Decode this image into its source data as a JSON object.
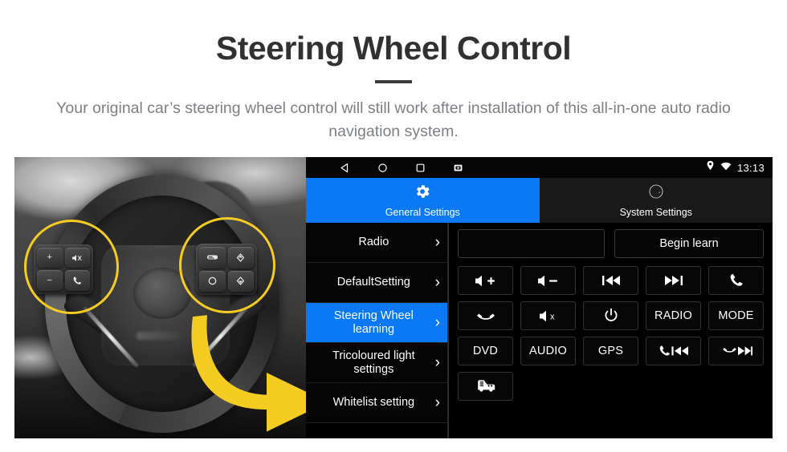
{
  "header": {
    "title": "Steering Wheel Control",
    "subtitle": "Your original car’s steering wheel control will still work after installation of this all-in-one auto radio navigation system."
  },
  "colors": {
    "accent_blue": "#0b79f5",
    "highlight_yellow": "#f5cc22",
    "screen_black": "#000000",
    "title_text": "#2f3133",
    "subtitle_text": "#7c8084"
  },
  "photo": {
    "caption": "steering-wheel-photo",
    "highlight_left": "left-control-cluster-highlight",
    "highlight_right": "right-control-cluster-highlight",
    "arrow": "yellow-arrow-pointing-right",
    "left_pod_keys": [
      "volume-up",
      "mute-voice",
      "volume-down",
      "phone-call"
    ],
    "right_pod_keys": [
      "display-list",
      "up-arrow",
      "enter-ok",
      "down-arrow"
    ]
  },
  "screen": {
    "statusbar": {
      "nav_icons": [
        "back-icon",
        "home-icon",
        "recents-icon",
        "screenshot-icon"
      ],
      "status_icons": [
        "location-pin-icon",
        "wifi-icon"
      ],
      "time": "13:13"
    },
    "tabs": [
      {
        "label": "General Settings",
        "icon": "gear-icon",
        "active": true
      },
      {
        "label": "System Settings",
        "icon": "aperture-icon",
        "active": false
      }
    ],
    "sidebar": [
      {
        "label": "Radio",
        "active": false
      },
      {
        "label": "DefaultSetting",
        "active": false
      },
      {
        "label": "Steering Wheel learning",
        "active": true
      },
      {
        "label": "Tricoloured light settings",
        "active": false
      },
      {
        "label": "Whitelist setting",
        "active": false
      }
    ],
    "panel": {
      "input_value": "",
      "input_placeholder": "",
      "begin_learn_label": "Begin learn",
      "buttons": [
        {
          "icon": "volume-up-icon",
          "label": ""
        },
        {
          "icon": "volume-down-icon",
          "label": ""
        },
        {
          "icon": "previous-track-icon",
          "label": ""
        },
        {
          "icon": "next-track-icon",
          "label": ""
        },
        {
          "icon": "phone-call-icon",
          "label": ""
        },
        {
          "icon": "phone-hangup-icon",
          "label": ""
        },
        {
          "icon": "mute-icon",
          "label": ""
        },
        {
          "icon": "power-icon",
          "label": ""
        },
        {
          "icon": "",
          "label": "RADIO"
        },
        {
          "icon": "",
          "label": "MODE"
        },
        {
          "icon": "",
          "label": "DVD"
        },
        {
          "icon": "",
          "label": "AUDIO"
        },
        {
          "icon": "",
          "label": "GPS"
        },
        {
          "icon": "phone-previous-icon",
          "label": ""
        },
        {
          "icon": "hangup-next-icon",
          "label": ""
        },
        {
          "icon": "car-info-icon",
          "label": ""
        }
      ]
    }
  }
}
